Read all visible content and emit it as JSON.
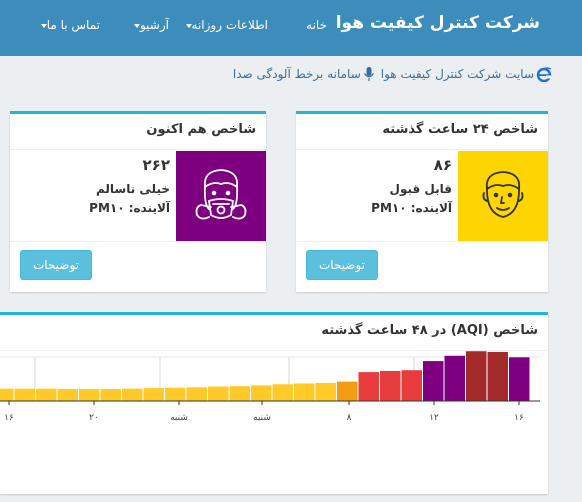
{
  "nav": {
    "brand": "شرکت کنترل کیفیت هوا",
    "home": "خانه",
    "daily": "اطلاعات روزانه",
    "archive": "آرشیو",
    "contact": "تماس با ما"
  },
  "links": {
    "site": "سایت شرکت کنترل کیفیت هوا",
    "voice": "سامانه برخط آلودگی صدا"
  },
  "card24": {
    "title": "شاخص ۲۴ ساعت گذشته",
    "value": "۸۶",
    "status": "قابل قبول",
    "pollutant": "آلاینده: PM۱۰",
    "button": "توضیحات",
    "color": "#ffd500"
  },
  "cardNow": {
    "title": "شاخص هم اکنون",
    "value": "۲۶۲",
    "status": "خیلی ناسالم",
    "pollutant": "آلاینده: PM۱۰",
    "button": "توضیحات",
    "color": "#7e0080"
  },
  "chart": {
    "title": "شاخص (AQI) در ۴۸ ساعت گذشته"
  },
  "chart_data": {
    "type": "bar",
    "title": "شاخص (AQI) در ۴۸ ساعت گذشته",
    "tick_labels": [
      "۱۶",
      "۱۲",
      "۸",
      "شنبه",
      "شنبه",
      "۲۰",
      "۱۶"
    ],
    "values": [
      55,
      55,
      55,
      55,
      55,
      55,
      55,
      57,
      57,
      57,
      57,
      57,
      58,
      58,
      60,
      62,
      70,
      72,
      72,
      75,
      65,
      65,
      65,
      63,
      63,
      63,
      65,
      68,
      70,
      72,
      76,
      78,
      82,
      88,
      92,
      95,
      102,
      152,
      158,
      162,
      210,
      238,
      262,
      258,
      230
    ],
    "color_scale": {
      "good": "#ffd42a",
      "moderate": "#ffc928",
      "sensitive": "#f39c12",
      "unhealthy": "#e83b3b",
      "very_unhealthy": "#7e0080",
      "hazardous": "#a52a2a"
    }
  }
}
